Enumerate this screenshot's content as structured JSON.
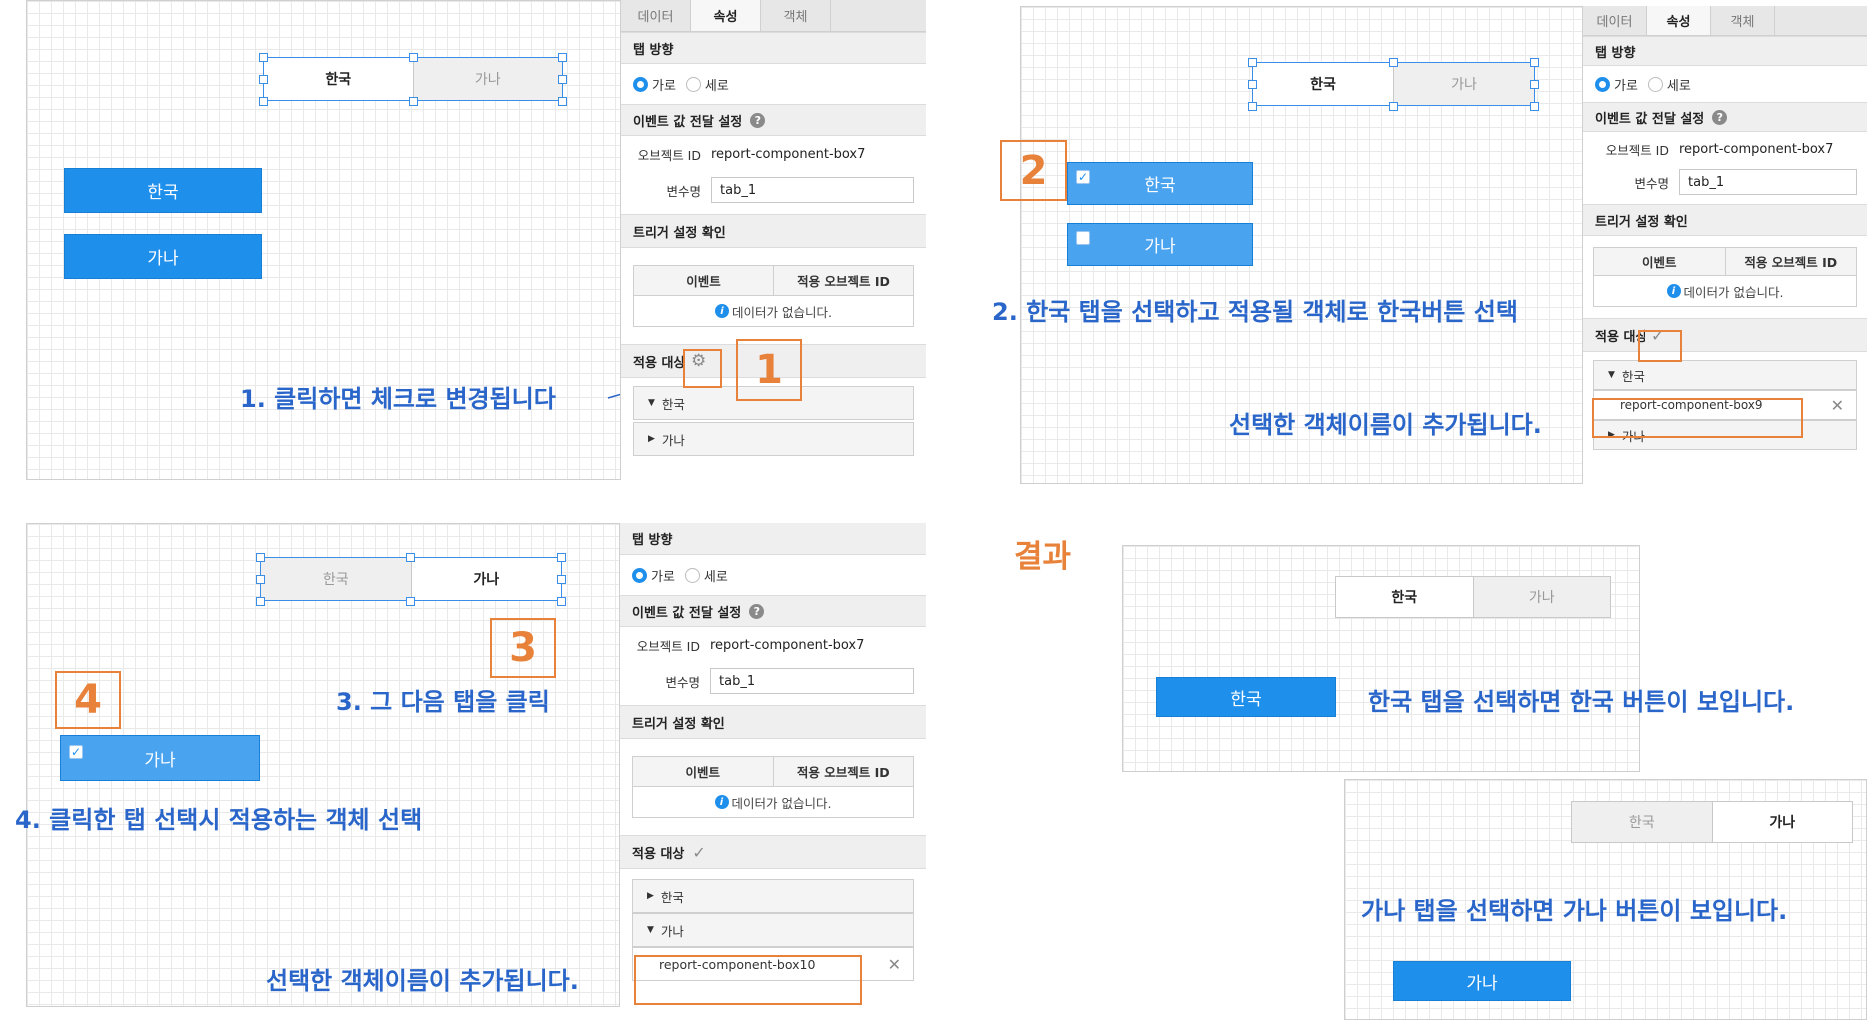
{
  "tabs_labels": {
    "korea": "한국",
    "gana": "가나"
  },
  "buttons": {
    "korea": "한국",
    "gana": "가나"
  },
  "panel": {
    "tabs": [
      "데이터",
      "속성",
      "객체"
    ],
    "tab_direction": "탭 방향",
    "radio_horizontal": "가로",
    "radio_vertical": "세로",
    "event_value": "이벤트 값 전달 설정",
    "help": "?",
    "object_id_label": "오브젝트 ID",
    "object_id_value": "report-component-box7",
    "varname_label": "변수명",
    "varname_value": "tab_1",
    "trigger_title": "트리거 설정 확인",
    "col_event": "이벤트",
    "col_apply_id": "적용 오브젝트 ID",
    "no_data": "데이터가 없습니다.",
    "apply_target": "적용 대상",
    "apply_target_cut": "적용 대상",
    "tree_korea": "한국",
    "tree_gana": "가나",
    "info": "i"
  },
  "icons": {
    "gear": "gear-icon",
    "check": "check-icon",
    "close": "close-icon",
    "triangle_down": "▼",
    "triangle_right": "▶",
    "checkmark": "✓",
    "x": "✕",
    "gear_glyph": "⚙"
  },
  "steps": {
    "n1": "1",
    "n2": "2",
    "n3": "3",
    "n4": "4",
    "s1": "1. 클릭하면 체크로 변경됩니다",
    "s2": "2. 한국 탭을 선택하고 적용될 객체로 한국버튼 선택",
    "s2b": "선택한 객체이름이 추가됩니다.",
    "s3": "3. 그 다음 탭을 클릭",
    "s4": "4. 클릭한 탭 선택시 적용하는 객체 선택",
    "s4b": "선택한 객체이름이 추가됩니다."
  },
  "selected": {
    "box9": "report-component-box9",
    "box10": "report-component-box10"
  },
  "result": {
    "title": "결과",
    "korea_note": "한국 탭을 선택하면 한국 버튼이 보입니다.",
    "gana_note": "가나 탭을 선택하면 가나 버튼이 보입니다."
  },
  "colors": {
    "accent": "#1f8fec",
    "orange": "#e8823a",
    "note": "#2a66c9"
  }
}
